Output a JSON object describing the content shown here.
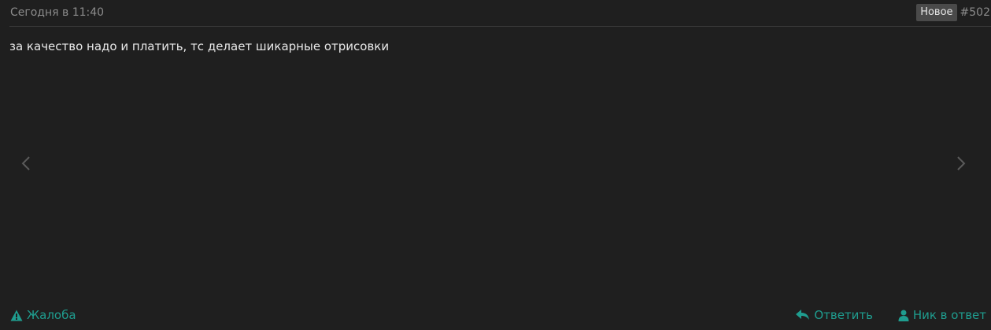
{
  "post": {
    "date": "Сегодня в 11:40",
    "badge": "Новое",
    "number": "#502",
    "text": "за качество надо и платить, тс делает шикарные отрисовки"
  },
  "footer": {
    "report_label": "Жалоба",
    "reply_label": "Ответить",
    "nick_reply_label": "Ник в ответ"
  },
  "icons": {
    "report": "warning-triangle-icon",
    "reply": "reply-arrow-icon",
    "nick": "user-icon",
    "prev": "chevron-left-icon",
    "next": "chevron-right-icon"
  },
  "colors": {
    "background": "#1f1f1f",
    "accent": "#1f9d8f",
    "muted_text": "#8c8c8c",
    "body_text": "#e8e8e8",
    "badge_bg": "#4a4a4a"
  }
}
